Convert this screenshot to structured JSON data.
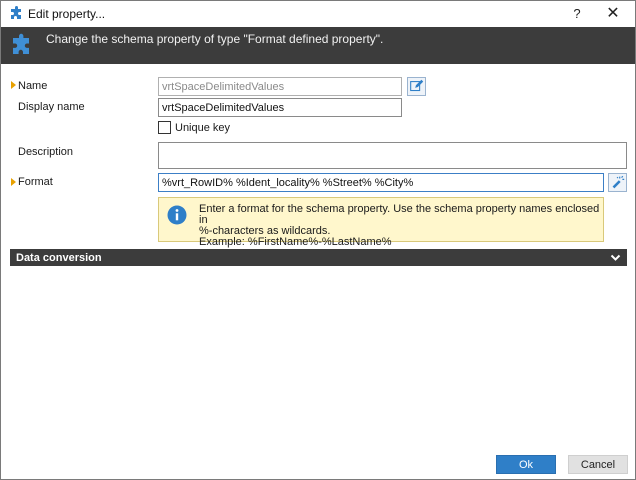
{
  "window": {
    "title": "Edit property...",
    "help_label": "?",
    "close_label": "✕"
  },
  "header": {
    "text": "Change the schema property of type \"Format defined property\"."
  },
  "form": {
    "name_label": "Name",
    "name_value": "vrtSpaceDelimitedValues",
    "display_name_label": "Display name",
    "display_name_value": "vrtSpaceDelimitedValues",
    "unique_key_label": "Unique key",
    "unique_key_checked": false,
    "description_label": "Description",
    "description_value": "",
    "format_label": "Format",
    "format_value": "%vrt_RowID% %Ident_locality% %Street% %City%"
  },
  "info": {
    "line1": "Enter a format for the schema property. Use the schema property names enclosed in",
    "line2": "%-characters as wildcards.",
    "line3": "Example: %FirstName%-%LastName%"
  },
  "sections": {
    "data_conversion_label": "Data conversion"
  },
  "buttons": {
    "ok_label": "Ok",
    "cancel_label": "Cancel"
  },
  "icons": {
    "app": "puzzle-icon",
    "header": "puzzle-icon",
    "edit": "edit-pencil-icon",
    "format_wizard": "wand-icon",
    "info": "info-icon",
    "chevron": "chevron-down-icon"
  },
  "colors": {
    "header_bg": "#3c3c3c",
    "accent_blue": "#2f7fc8",
    "required_marker": "#e8a100",
    "info_bg": "#fff7cc"
  }
}
